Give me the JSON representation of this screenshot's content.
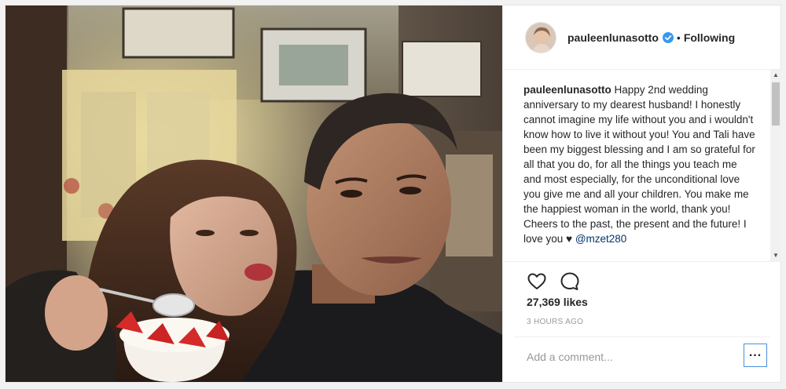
{
  "post": {
    "username": "pauleenlunasotto",
    "follow_separator": "•",
    "follow_status": "Following",
    "caption_text": "Happy 2nd wedding anniversary to my dearest husband! I honestly cannot imagine my life without you and i wouldn't know how to live it without you! You and Tali have been my biggest blessing and I am so grateful for all that you do, for all the things you teach me and most especially, for the unconditional love you give me and all your children. You make me the happiest woman in the world, thank you! Cheers to the past, the present and the future! I love you ♥",
    "mention": "@mzet280",
    "likes": "27,369 likes",
    "time_ago": "3 HOURS AGO",
    "comment_placeholder": "Add a comment...",
    "more_label": "..."
  },
  "icons": {
    "verified": "verified-badge-icon",
    "like": "heart-icon",
    "comment": "comment-bubble-icon",
    "scroll_up": "▲",
    "scroll_down": "▼"
  },
  "colors": {
    "verified_blue": "#3897f0",
    "mention": "#003569",
    "more_button_border": "#4a90d9"
  }
}
